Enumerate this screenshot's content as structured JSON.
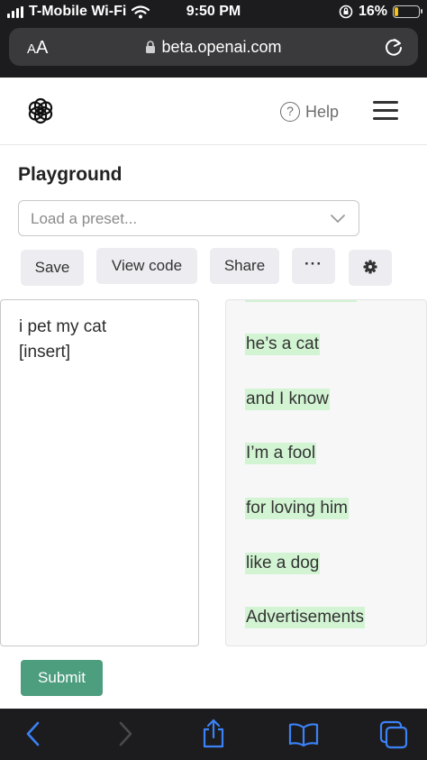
{
  "status_bar": {
    "carrier": "T-Mobile Wi-Fi",
    "time": "9:50 PM",
    "battery_percent": "16%",
    "battery_level": 0.16
  },
  "browser": {
    "text_size_label_small": "A",
    "text_size_label_large": "A",
    "url": "beta.openai.com"
  },
  "header": {
    "help_label": "Help",
    "help_icon_glyph": "?"
  },
  "page": {
    "title": "Playground",
    "preset_placeholder": "Load a preset..."
  },
  "toolbar_buttons": {
    "save": "Save",
    "view_code": "View code",
    "share": "Share",
    "more": "···"
  },
  "prompt": {
    "text": "i pet my cat\n[insert]"
  },
  "output": {
    "lines": [
      "he’s a cat",
      "and I know",
      "I’m a fool",
      "for loving him",
      "like a dog",
      "Advertisements"
    ],
    "highlight_color": "#d2f4d3"
  },
  "submit_label": "Submit",
  "colors": {
    "accent": "#4d9d7f",
    "safari_chrome": "#1c1c1e",
    "safari_blue": "#3b82f6"
  }
}
